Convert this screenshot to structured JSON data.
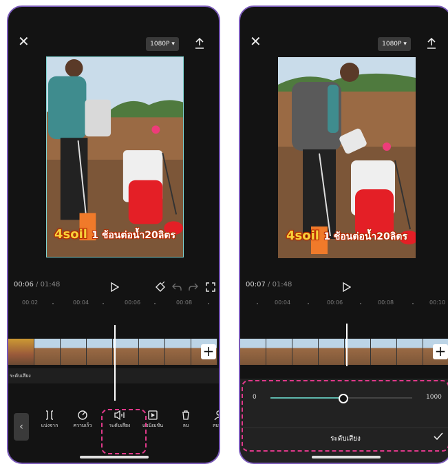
{
  "left_screen": {
    "resolution_label": "1080P",
    "caption_main": "4soil",
    "caption_rest": "1 ช้อนต่อน้ำ20ลิตร",
    "time_current": "00:06",
    "time_separator": " / ",
    "time_total": "01:48",
    "ruler_ticks": [
      "00:02",
      "00:04",
      "00:06",
      "00:08"
    ],
    "audio_track_label": "ระดับเสียง",
    "add_clip_label": "+",
    "tools": [
      {
        "icon": "split-icon",
        "label": "แบ่งจาก"
      },
      {
        "icon": "speed-icon",
        "label": "ความเร็ว"
      },
      {
        "icon": "volume-icon",
        "label": "ระดับเสียง"
      },
      {
        "icon": "animation-icon",
        "label": "แอนิเมชัน"
      },
      {
        "icon": "delete-icon",
        "label": "ลบ"
      },
      {
        "icon": "remove-bg-icon",
        "label": "ลบพื้น"
      }
    ]
  },
  "right_screen": {
    "resolution_label": "1080P",
    "caption_main": "4soil",
    "caption_rest": "1 ช้อนต่อน้ำ20ลิตร",
    "time_current": "00:07",
    "time_separator": " / ",
    "time_total": "01:48",
    "ruler_ticks": [
      "00:04",
      "00:06",
      "00:08",
      "00:10"
    ],
    "add_clip_label": "+",
    "volume": {
      "min_label": "0",
      "max_label": "1000",
      "value_fraction": 0.51,
      "title": "ระดับเสียง"
    }
  },
  "colors": {
    "highlight_dash": "#e0398a",
    "slider_fill": "#5fb8ae",
    "phone_border": "#7a5ab8"
  }
}
